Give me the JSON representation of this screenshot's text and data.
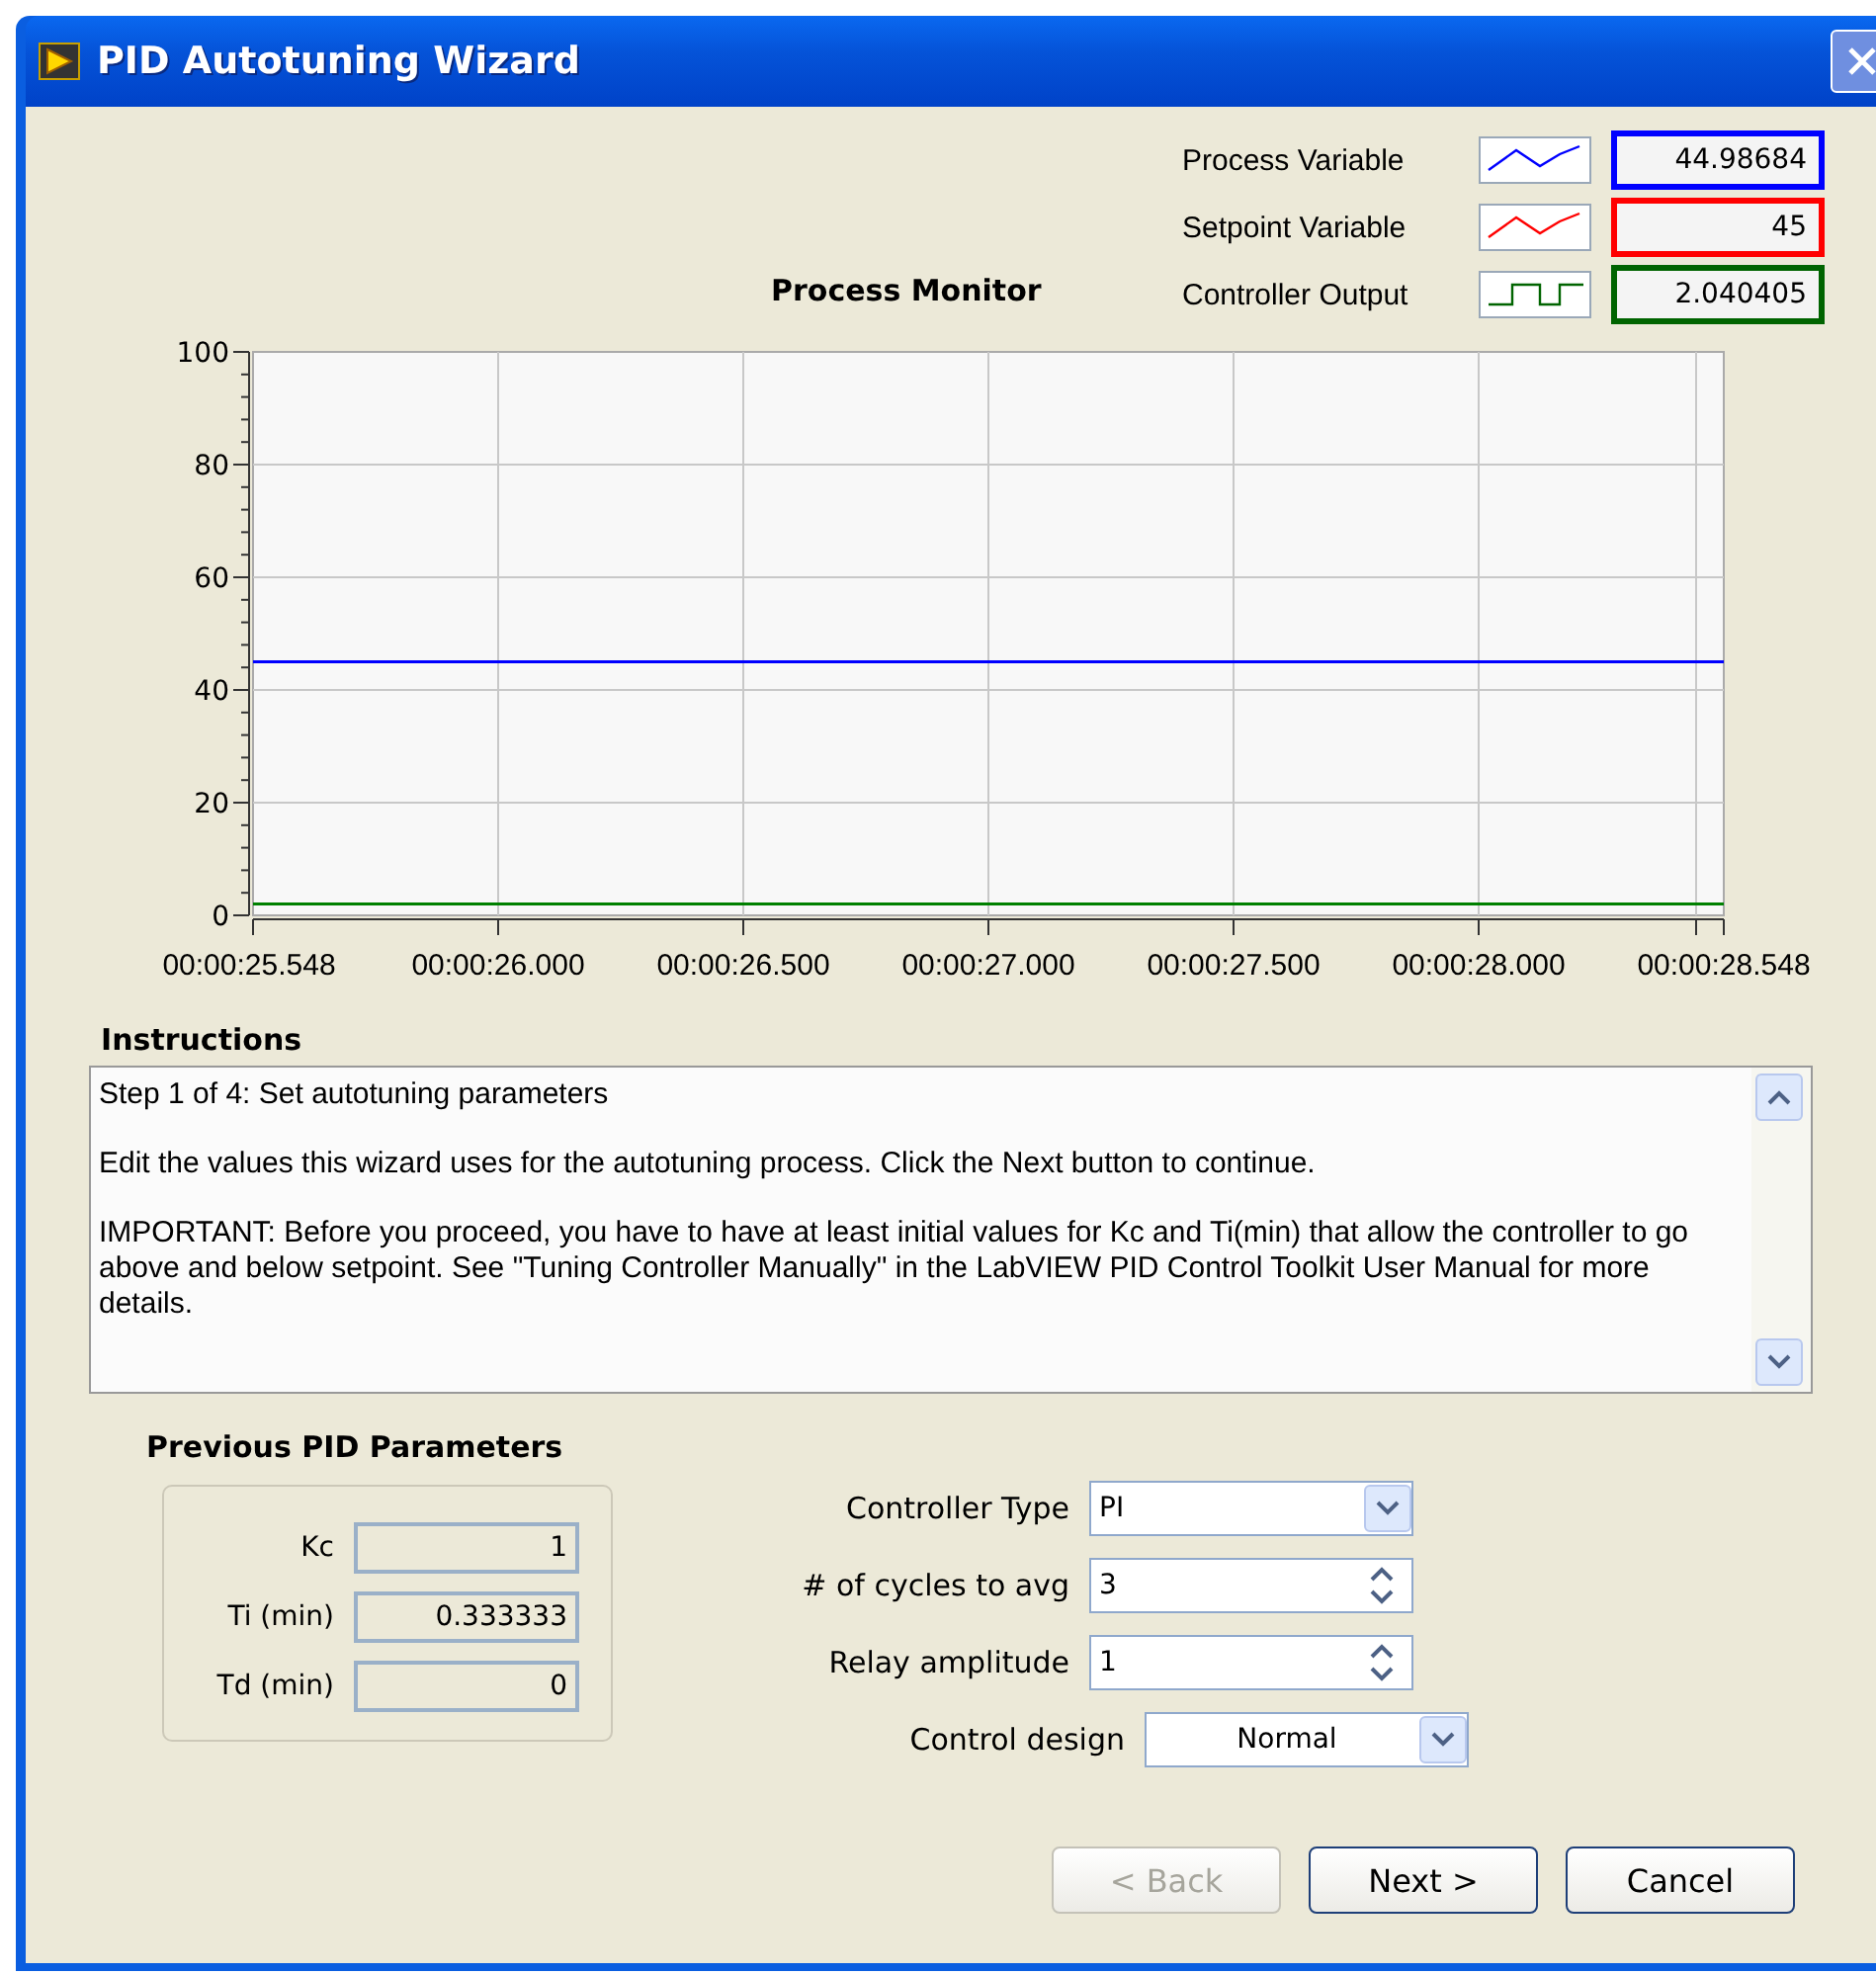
{
  "window": {
    "title": "PID Autotuning Wizard"
  },
  "monitor": {
    "title": "Process Monitor",
    "legend": [
      {
        "name": "Process Variable",
        "color": "#0000ff",
        "kind": "wave",
        "value": "44.98684"
      },
      {
        "name": "Setpoint Variable",
        "color": "#ff0000",
        "kind": "wave",
        "value": "45"
      },
      {
        "name": "Controller Output",
        "color": "#006400",
        "kind": "square",
        "value": "2.040405"
      }
    ],
    "chart_data": {
      "type": "line",
      "grid": true,
      "categories": [
        "00:00:25.548",
        "00:00:26.000",
        "00:00:26.500",
        "00:00:27.000",
        "00:00:27.500",
        "00:00:28.000",
        "00:00:28.548"
      ],
      "ylim": [
        0,
        100
      ],
      "yticks": [
        0,
        20,
        40,
        60,
        80,
        100
      ],
      "series": [
        {
          "color": "#0000ff",
          "values": [
            45,
            45,
            45,
            45,
            45,
            45,
            45
          ]
        },
        {
          "color": "#008000",
          "values": [
            2,
            2,
            2,
            2,
            2,
            2,
            2
          ]
        }
      ]
    }
  },
  "instructions": {
    "heading": "Instructions",
    "paragraphs": [
      "Step 1 of 4:  Set autotuning parameters",
      "Edit the values this wizard uses for the autotuning process. Click the Next button to continue.",
      "IMPORTANT: Before you proceed, you have to have at least initial values for Kc and Ti(min) that allow the controller to go above and below setpoint. See \"Tuning Controller Manually\" in the LabVIEW PID Control Toolkit User Manual for more details."
    ]
  },
  "previous_parameters": {
    "heading": "Previous PID Parameters",
    "fields": [
      {
        "label": "Kc",
        "value": "1"
      },
      {
        "label": "Ti (min)",
        "value": "0.333333"
      },
      {
        "label": "Td (min)",
        "value": "0"
      }
    ]
  },
  "settings": [
    {
      "label": "Controller Type",
      "kind": "dropdown",
      "value": "PI"
    },
    {
      "label": "# of cycles to avg",
      "kind": "spinner",
      "value": "3"
    },
    {
      "label": "Relay amplitude",
      "kind": "spinner",
      "value": "1"
    },
    {
      "label": "Control design",
      "kind": "dropdown",
      "value": "Normal"
    }
  ],
  "buttons": [
    {
      "label": "< Back",
      "disabled": true
    },
    {
      "label": "Next >",
      "disabled": false
    },
    {
      "label": "Cancel",
      "disabled": false
    }
  ]
}
